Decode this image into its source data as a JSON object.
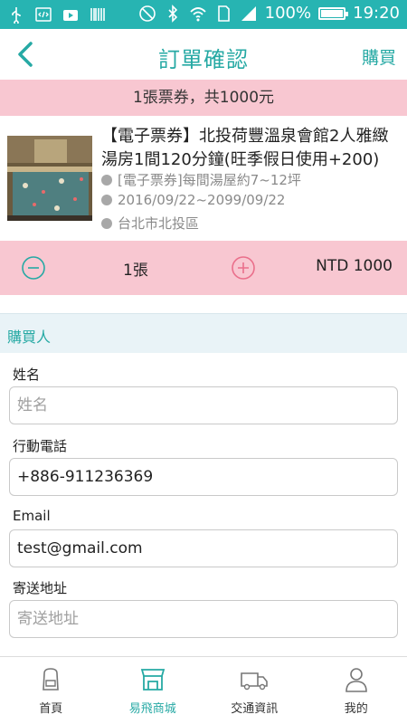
{
  "status_bar": {
    "battery_text": "100%",
    "time": "19:20",
    "battery_level": 1.0
  },
  "header": {
    "title": "訂單確認",
    "buy_label": "購買"
  },
  "summary": {
    "text": "1張票券，共1000元"
  },
  "product": {
    "title": "【電子票券】北投荷豐溫泉會館2人雅緻湯房1間120分鐘(旺季假日使用+200)",
    "detail": "[電子票券]每間湯屋約7~12坪",
    "date_range": "2016/09/22~2099/09/22",
    "location": "台北市北投區"
  },
  "quantity": {
    "count_label": "1張",
    "price_label": "NTD 1000"
  },
  "buyer": {
    "section_title": "購買人",
    "name_label": "姓名",
    "name_placeholder": "姓名",
    "phone_label": "行動電話",
    "phone_value": "+886-911236369",
    "email_label": "Email",
    "email_value": "test@gmail.com",
    "address_label": "寄送地址",
    "address_placeholder": "寄送地址"
  },
  "bottom_nav": {
    "items": [
      {
        "label": "首頁",
        "icon": "backpack-icon"
      },
      {
        "label": "易飛商城",
        "icon": "store-icon"
      },
      {
        "label": "交通資訊",
        "icon": "truck-icon"
      },
      {
        "label": "我的",
        "icon": "person-icon"
      }
    ],
    "active_index": 1
  },
  "colors": {
    "accent": "#26a9a4",
    "status_bar": "#27b4b2",
    "pink_bar": "#f8c7d1",
    "section_bg": "#e9f3f7"
  }
}
